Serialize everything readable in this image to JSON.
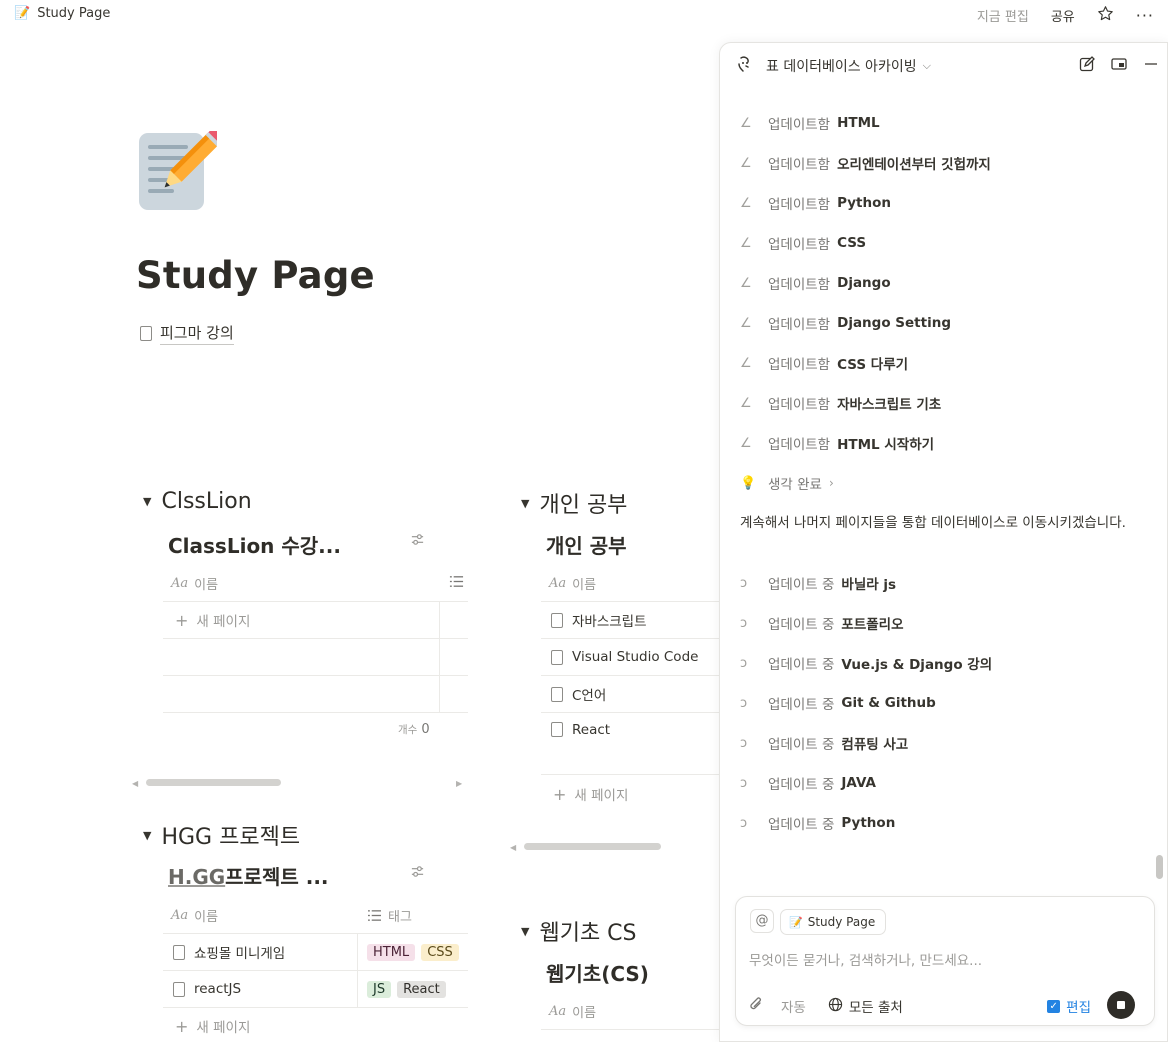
{
  "topbar": {
    "page_name": "Study Page",
    "edited": "지금 편집",
    "share": "공유",
    "star_icon": "star-icon",
    "more_icon": "ellipsis-icon"
  },
  "page": {
    "title": "Study Page",
    "child_page": "피그마 강의"
  },
  "sections": {
    "clsslion": {
      "toggle": "ClssLion",
      "db_title": "ClassLion 수강...",
      "col_name": "이름",
      "new_page": "새 페이지",
      "count_label": "개수",
      "count_value": "0"
    },
    "personal": {
      "toggle": "개인 공부",
      "db_title": "개인 공부",
      "col_name": "이름",
      "rows": [
        "자바스크립트",
        "Visual Studio Code",
        "C언어",
        "React"
      ],
      "new_page": "새 페이지"
    },
    "hgg": {
      "toggle": "HGG 프로젝트",
      "db_title_underlined": "H.GG",
      "db_title_rest": "프로젝트 ...",
      "col_name": "이름",
      "col_tag": "태그",
      "rows": [
        {
          "name": "쇼핑몰 미니게임",
          "tags": [
            "HTML",
            "CSS"
          ]
        },
        {
          "name": "reactJS",
          "tags": [
            "JS",
            "React"
          ]
        }
      ],
      "new_page": "새 페이지"
    },
    "webcs": {
      "toggle": "웹기초 CS",
      "db_title": "웹기초(CS)",
      "col_name": "이름"
    }
  },
  "tag_colors": {
    "HTML": {
      "bg": "#f5e0e9",
      "fg": "#4c2337"
    },
    "CSS": {
      "bg": "#fbeecc",
      "fg": "#5a4a1a"
    },
    "JS": {
      "bg": "#dbeddb",
      "fg": "#1c3829"
    },
    "React": {
      "bg": "#e3e2e0",
      "fg": "#32302c"
    }
  },
  "assistant": {
    "header_title": "표 데이터베이스 아카이빙",
    "updated_items": [
      {
        "verb": "업데이트함",
        "obj": "HTML"
      },
      {
        "verb": "업데이트함",
        "obj": "오리엔테이션부터 깃헙까지"
      },
      {
        "verb": "업데이트함",
        "obj": "Python"
      },
      {
        "verb": "업데이트함",
        "obj": "CSS"
      },
      {
        "verb": "업데이트함",
        "obj": "Django"
      },
      {
        "verb": "업데이트함",
        "obj": "Django Setting"
      },
      {
        "verb": "업데이트함",
        "obj": "CSS 다루기"
      },
      {
        "verb": "업데이트함",
        "obj": "자바스크립트 기초"
      },
      {
        "verb": "업데이트함",
        "obj": "HTML 시작하기"
      }
    ],
    "thought": "생각 완료",
    "message": "계속해서 나머지 페이지들을 통합 데이터베이스로 이동시키겠습니다.",
    "updating_items": [
      {
        "verb": "업데이트 중",
        "obj": "바닐라 js"
      },
      {
        "verb": "업데이트 중",
        "obj": "포트폴리오"
      },
      {
        "verb": "업데이트 중",
        "obj": "Vue.js & Django 강의"
      },
      {
        "verb": "업데이트 중",
        "obj": "Git & Github"
      },
      {
        "verb": "업데이트 중",
        "obj": "컴퓨팅 사고"
      },
      {
        "verb": "업데이트 중",
        "obj": "JAVA"
      },
      {
        "verb": "업데이트 중",
        "obj": "Python"
      }
    ],
    "composer": {
      "mention": "@",
      "context_chip": "Study Page",
      "placeholder": "무엇이든 묻거나, 검색하거나, 만드세요...",
      "auto": "자동",
      "sources": "모든 출처",
      "edit": "편집"
    }
  }
}
